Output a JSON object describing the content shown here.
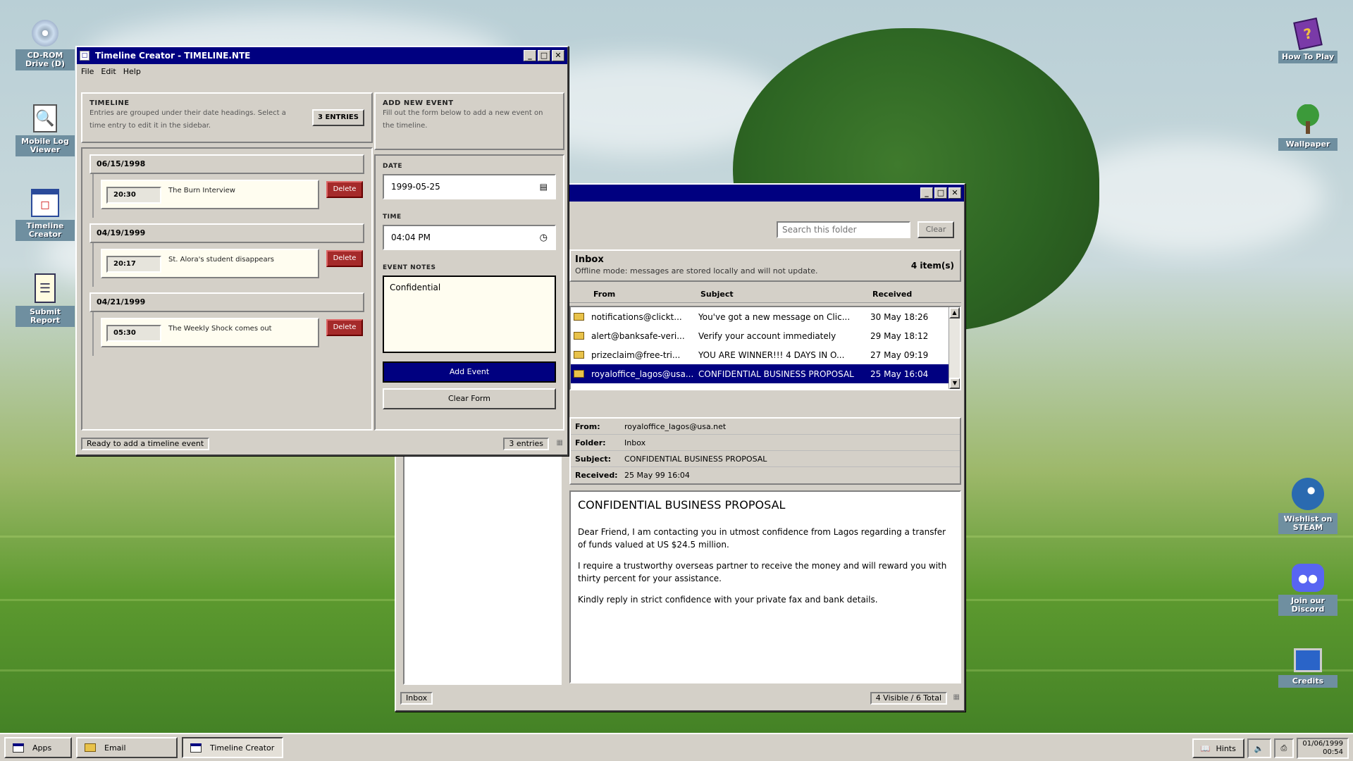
{
  "desktop_icons_left": [
    {
      "label": "CD-ROM Drive (D)",
      "icon": "cd-rom-icon"
    },
    {
      "label": "Mobile Log Viewer",
      "icon": "magnifier-document-icon"
    },
    {
      "label": "Timeline Creator",
      "icon": "calendar-icon"
    },
    {
      "label": "Submit Report",
      "icon": "clipboard-icon"
    }
  ],
  "desktop_icons_right": [
    {
      "label": "How To Play",
      "icon": "help-book-icon"
    },
    {
      "label": "Wallpaper",
      "icon": "tree-icon"
    },
    {
      "label": "Wishlist on STEAM",
      "icon": "steam-icon"
    },
    {
      "label": "Join our Discord",
      "icon": "discord-icon"
    },
    {
      "label": "Credits",
      "icon": "monitor-icon"
    }
  ],
  "timeline_window": {
    "title": "Timeline Creator - TIMELINE.NTE",
    "menu": [
      "File",
      "Edit",
      "Help"
    ],
    "timeline_heading": "TIMELINE",
    "timeline_desc": "Entries are grouped under their date headings. Select a time entry to edit it in the sidebar.",
    "entries_badge": "3 ENTRIES",
    "groups": [
      {
        "date": "06/15/1998",
        "entries": [
          {
            "time": "20:30",
            "title": "The Burn Interview",
            "delete": "Delete"
          }
        ]
      },
      {
        "date": "04/19/1999",
        "entries": [
          {
            "time": "20:17",
            "title": "St. Alora's student disappears",
            "delete": "Delete"
          }
        ]
      },
      {
        "date": "04/21/1999",
        "entries": [
          {
            "time": "05:30",
            "title": "The Weekly Shock comes out",
            "delete": "Delete"
          }
        ]
      }
    ],
    "form": {
      "heading": "ADD NEW EVENT",
      "desc": "Fill out the form below to add a new event on the timeline.",
      "date_label": "DATE",
      "date_value": "1999-05-25",
      "time_label": "TIME",
      "time_value": "04:04 PM",
      "notes_label": "EVENT NOTES",
      "notes_value": "Confidential",
      "add_button": "Add Event",
      "clear_button": "Clear Form"
    },
    "status_left": "Ready to add a timeline event",
    "status_right": "3 entries"
  },
  "email_window": {
    "search_placeholder": "Search this folder",
    "clear_button": "Clear",
    "folder_name": "Inbox",
    "folder_desc": "Offline mode: messages are stored locally and will not update.",
    "item_count": "4 item(s)",
    "columns": {
      "from": "From",
      "subject": "Subject",
      "received": "Received"
    },
    "messages": [
      {
        "from": "notifications@clickt...",
        "subject": "You've got a new message on Clic...",
        "received": "30 May 18:26"
      },
      {
        "from": "alert@banksafe-veri...",
        "subject": "Verify your account immediately",
        "received": "29 May 18:12"
      },
      {
        "from": "prizeclaim@free-tri...",
        "subject": "YOU ARE WINNER!!! 4 DAYS IN O...",
        "received": "27 May 09:19"
      },
      {
        "from": "royaloffice_lagos@usa....",
        "subject": "CONFIDENTIAL BUSINESS PROPOSAL",
        "received": "25 May 16:04"
      }
    ],
    "detail": {
      "from_label": "From:",
      "from": "royaloffice_lagos@usa.net",
      "folder_label": "Folder:",
      "folder": "Inbox",
      "subject_label": "Subject:",
      "subject": "CONFIDENTIAL BUSINESS PROPOSAL",
      "received_label": "Received:",
      "received": "25 May 99 16:04"
    },
    "body": {
      "heading": "CONFIDENTIAL BUSINESS PROPOSAL",
      "p1": "Dear Friend, I am contacting you in utmost confidence from Lagos regarding a transfer of funds valued at US $24.5 million.",
      "p2": "I require a trustworthy overseas partner to receive the money and will reward you with thirty percent for your assistance.",
      "p3": "Kindly reply in strict confidence with your private fax and bank details."
    },
    "status_left": "Inbox",
    "status_right": "4 Visible / 6 Total"
  },
  "taskbar": {
    "apps": "Apps",
    "tasks": [
      {
        "label": "Email",
        "icon": "envelope-icon"
      },
      {
        "label": "Timeline Creator",
        "icon": "calendar-icon"
      }
    ],
    "hints": "Hints",
    "clock_date": "01/06/1999",
    "clock_time": "00:54"
  }
}
